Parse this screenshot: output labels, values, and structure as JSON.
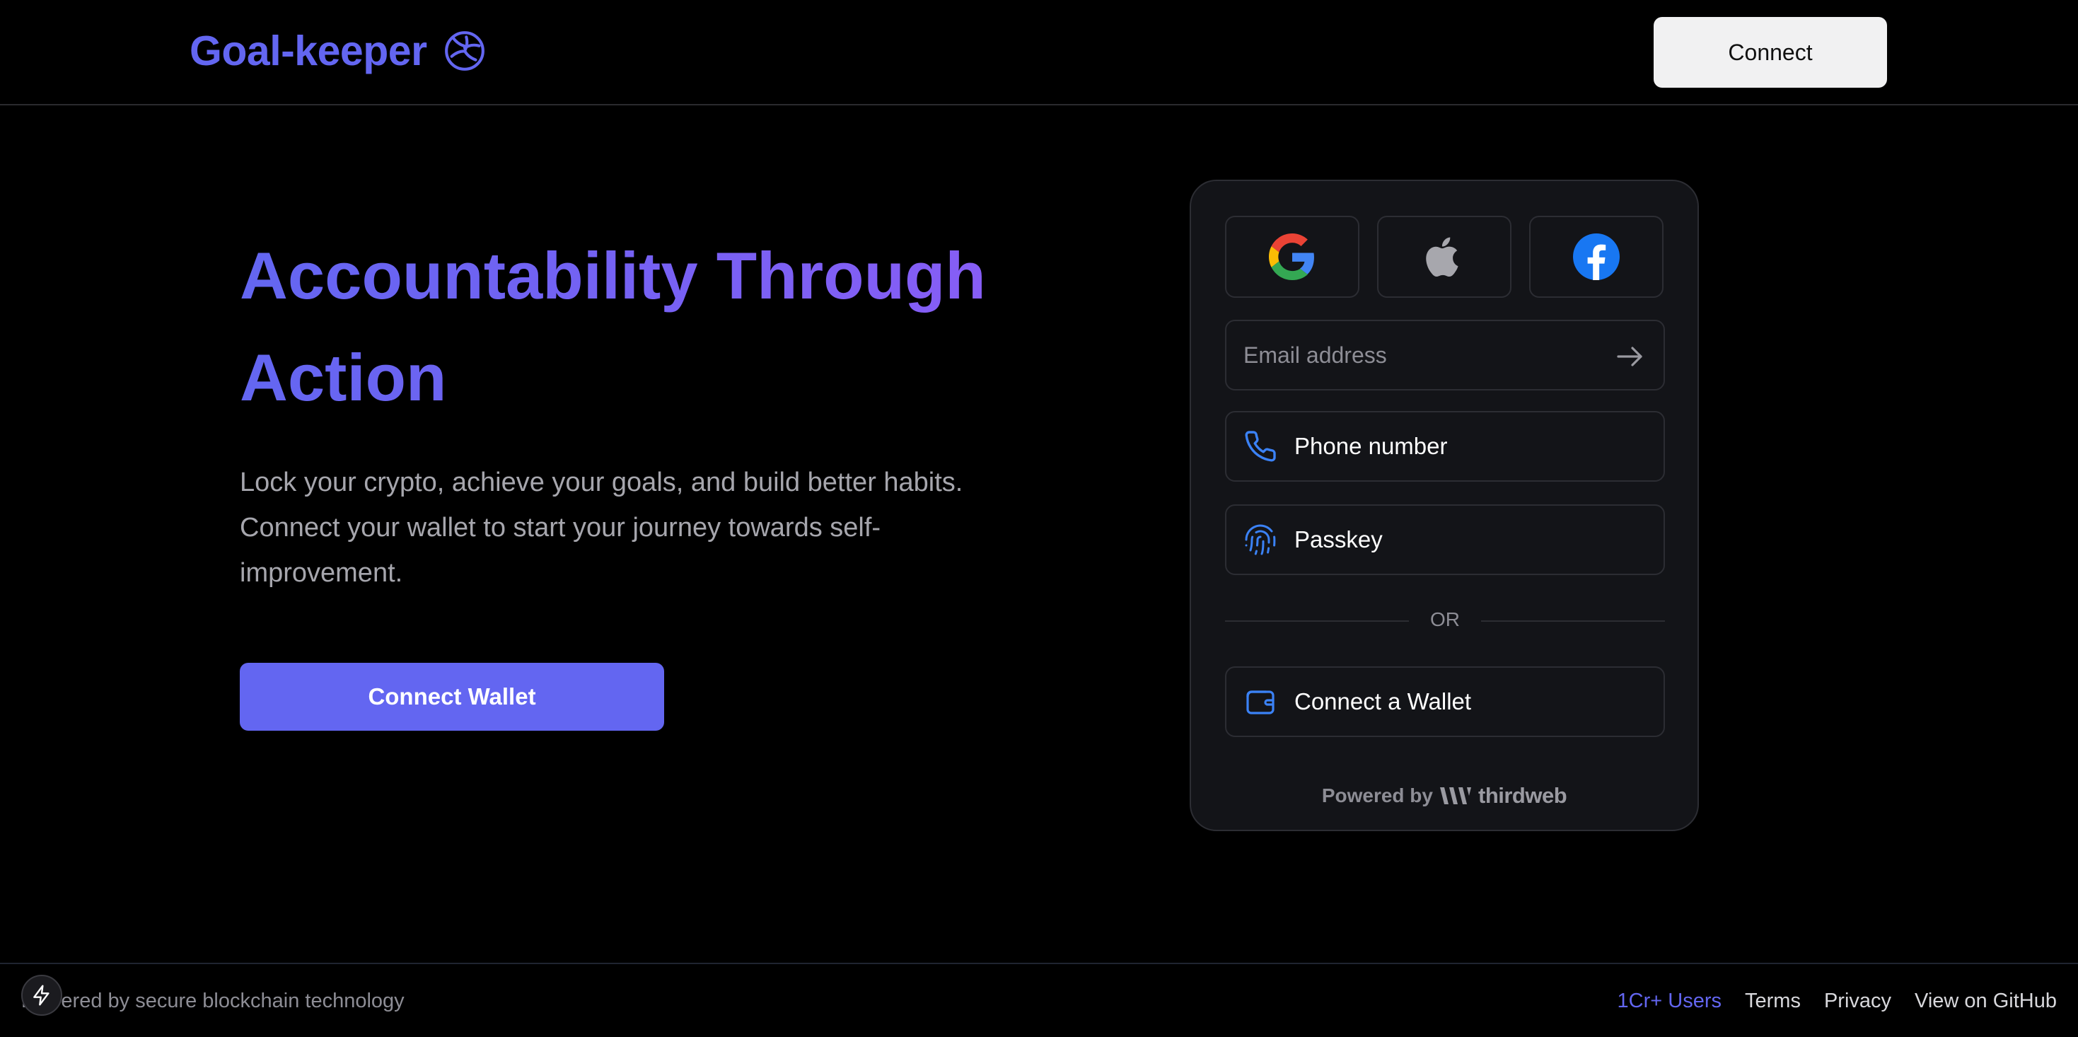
{
  "brand": {
    "name": "Goal-keeper",
    "icon": "volleyball-icon"
  },
  "header": {
    "connect_label": "Connect"
  },
  "hero": {
    "title": "Accountability Through Action",
    "description": "Lock your crypto, achieve your goals, and build better habits. Connect your wallet to start your journey towards self-improvement.",
    "cta_label": "Connect Wallet"
  },
  "login": {
    "social": [
      {
        "name": "google",
        "icon": "google-icon"
      },
      {
        "name": "apple",
        "icon": "apple-icon"
      },
      {
        "name": "facebook",
        "icon": "facebook-icon"
      }
    ],
    "email_placeholder": "Email address",
    "phone_label": "Phone number",
    "passkey_label": "Passkey",
    "divider_label": "OR",
    "wallet_label": "Connect a Wallet",
    "powered_by_label": "Powered by",
    "powered_by_brand": "thirdweb"
  },
  "footer": {
    "text": "Powered by secure blockchain technology",
    "links": [
      "1Cr+ Users",
      "Terms",
      "Privacy",
      "View on GitHub"
    ]
  },
  "colors": {
    "accent": "#6366f1",
    "accent_gradient_end": "#8b5cf6",
    "background": "#000000",
    "card": "#131418",
    "icon_blue": "#3b82f6"
  }
}
